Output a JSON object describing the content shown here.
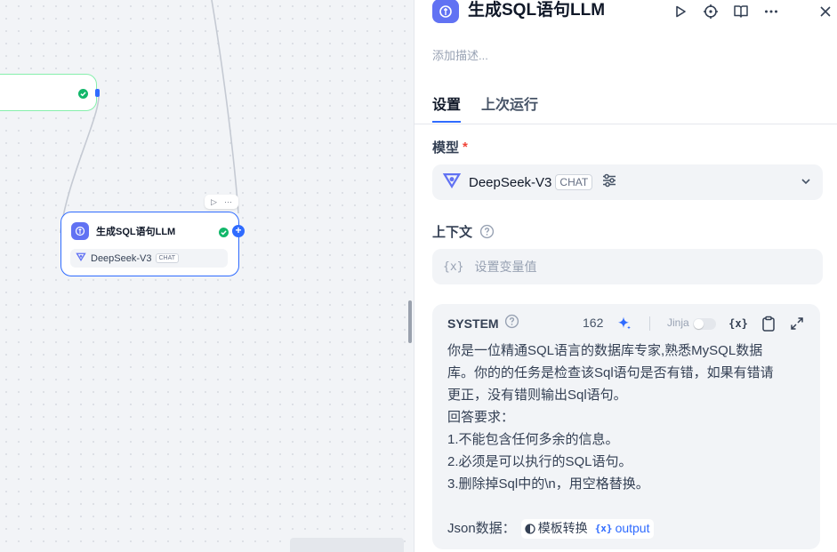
{
  "canvas": {
    "node": {
      "title": "生成SQL语句LLM",
      "model": "DeepSeek-V3",
      "model_tag": "CHAT",
      "toolbar": {
        "run": "▷",
        "more": "···"
      }
    }
  },
  "panel": {
    "title": "生成SQL语句LLM",
    "description_placeholder": "添加描述...",
    "tabs": [
      {
        "label": "设置"
      },
      {
        "label": "上次运行"
      }
    ],
    "model_section": {
      "label": "模型",
      "required_mark": "*",
      "model_name": "DeepSeek-V3",
      "model_tag": "CHAT"
    },
    "context_section": {
      "label": "上下文",
      "brace": "{x}",
      "placeholder": "设置变量值"
    },
    "system": {
      "label": "SYSTEM",
      "char_count": "162",
      "jinja_label": "Jinja",
      "var_tool": "{x}",
      "lines": [
        "你是一位精通SQL语言的数据库专家,熟悉MySQL数据",
        "库。你的的任务是检查该Sql语句是否有错，如果有错请",
        "更正，没有错则输出Sql语句。",
        "回答要求：",
        "1.不能包含任何多余的信息。",
        "2.必须是可以执行的SQL语句。",
        "3.删除掉Sql中的\\n，用空格替换。"
      ],
      "json_label": "Json数据：",
      "var_node": "模板转换",
      "var_brace": "{x}",
      "var_name": "output"
    }
  },
  "colors": {
    "accent": "#2f6bff",
    "llm_badge": "#6172f3",
    "success": "#12b76a",
    "required": "#f04438"
  }
}
